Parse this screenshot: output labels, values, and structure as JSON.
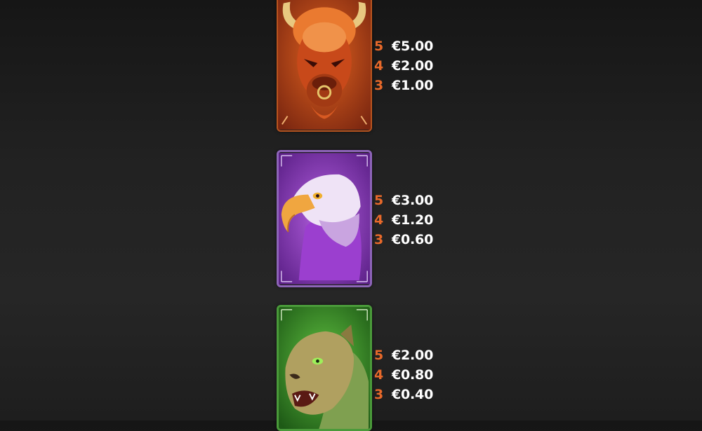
{
  "paytable": [
    {
      "symbol_icon": "bison-icon",
      "color": "#c8491a",
      "rows": [
        {
          "count": "5",
          "amount": "€5.00"
        },
        {
          "count": "4",
          "amount": "€2.00"
        },
        {
          "count": "3",
          "amount": "€1.00"
        }
      ]
    },
    {
      "symbol_icon": "eagle-icon",
      "color": "#8a3bb5",
      "rows": [
        {
          "count": "5",
          "amount": "€3.00"
        },
        {
          "count": "4",
          "amount": "€1.20"
        },
        {
          "count": "3",
          "amount": "€0.60"
        }
      ]
    },
    {
      "symbol_icon": "puma-icon",
      "color": "#3f8a2c",
      "rows": [
        {
          "count": "5",
          "amount": "€2.00"
        },
        {
          "count": "4",
          "amount": "€0.80"
        },
        {
          "count": "3",
          "amount": "€0.40"
        }
      ]
    }
  ],
  "colors": {
    "count_color": "#e8692a",
    "amount_color": "#ffffff",
    "background": "#222222"
  }
}
